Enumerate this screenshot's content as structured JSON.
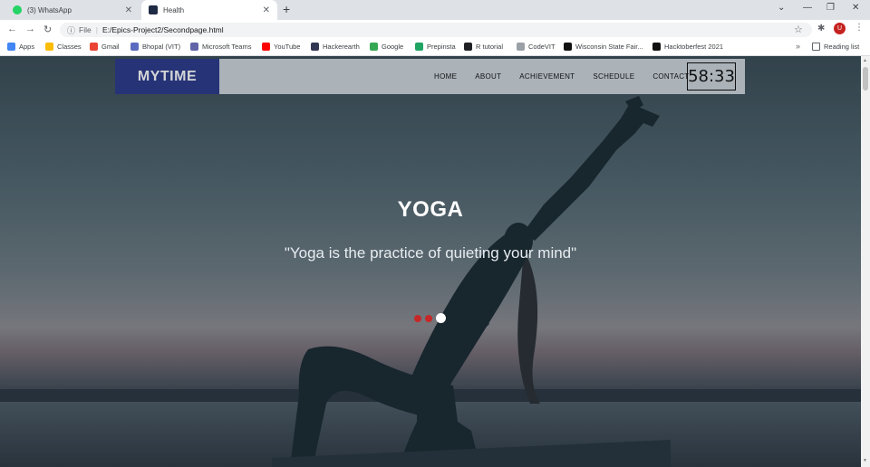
{
  "browser": {
    "tabs": [
      {
        "title": "(3) WhatsApp",
        "active": false
      },
      {
        "title": "Health",
        "active": true
      }
    ],
    "new_tab": "+",
    "window_controls": [
      "⌄",
      "—",
      "❐",
      "✕"
    ],
    "address": {
      "info": "ⓘ",
      "scheme": "File",
      "separator": "|",
      "url": "E:/Epics-Project2/Secondpage.html"
    },
    "avatar_letter": "U",
    "bookmarks": [
      {
        "label": "Apps",
        "color": "#4285f4"
      },
      {
        "label": "Classes",
        "color": "#fbbc04"
      },
      {
        "label": "Gmail",
        "color": "#ea4335"
      },
      {
        "label": "Bhopal (VIT)",
        "color": "#5b6bbf"
      },
      {
        "label": "Microsoft Teams",
        "color": "#6264a7"
      },
      {
        "label": "YouTube",
        "color": "#ff0000"
      },
      {
        "label": "Hackerearth",
        "color": "#323754"
      },
      {
        "label": "Google",
        "color": "#34a853"
      },
      {
        "label": "Prepinsta",
        "color": "#1fa463"
      },
      {
        "label": "R tutorial",
        "color": "#202124"
      },
      {
        "label": "CodeVIT",
        "color": "#9aa0a6"
      },
      {
        "label": "Wisconsin State Fair...",
        "color": "#111111"
      },
      {
        "label": "Hacktoberfest 2021",
        "color": "#111111"
      }
    ],
    "bookmarks_more": "»",
    "reading_list": "Reading list"
  },
  "site": {
    "brand": "MYTIME",
    "nav": [
      "HOME",
      "ABOUT",
      "ACHIEVEMENT",
      "SCHEDULE",
      "CONTACT"
    ],
    "clock": "58:33",
    "hero": {
      "title": "YOGA",
      "quote": "\"Yoga is the practice of quieting your mind\""
    },
    "slider_dots": 3,
    "active_dot": 3
  },
  "colors": {
    "brand_bg": "#2d3a8c",
    "nav_bg": "#cfd5db",
    "dot_inactive": "#c62828",
    "dot_active": "#ffffff"
  }
}
